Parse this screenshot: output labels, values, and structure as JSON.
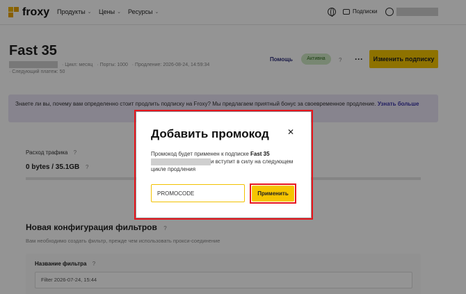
{
  "nav": {
    "logo_text": "froxy",
    "menu": [
      {
        "label": "Продукты"
      },
      {
        "label": "Цены"
      },
      {
        "label": "Ресурсы"
      }
    ],
    "subscriptions_label": "Подписки"
  },
  "page": {
    "title": "Fast 35",
    "meta_cycle": "· Цикл: месяц",
    "meta_ports": "· Порты: 1000",
    "meta_renewal": "· Продление: 2026-08-24, 14:59:34",
    "meta_next_payment": "· Следующий платеж: 50",
    "help_link": "Помощь",
    "status_badge": "Активна",
    "more_label": "···",
    "change_button": "Изменить подписку"
  },
  "notice": {
    "text": "Знаете ли вы, почему вам определенно стоит продлить подписку на Froxy? Мы предлагаем приятный бонус за своевременное продление. ",
    "link": "Узнать больше"
  },
  "traffic": {
    "label": "Расход трафика",
    "value": "0 bytes / 35.1GB",
    "used_fraction": 0
  },
  "filters": {
    "section_title": "Новая конфигурация фильтров",
    "section_sub": "Вам необходимо создать фильтр, прежде чем использовать прокси-соединение",
    "name_label": "Название фильтра",
    "name_value": "Filter 2026-07-24, 15:44"
  },
  "modal": {
    "title": "Добавить промокод",
    "text_before": "Промокод будет применен к подписке ",
    "subscription_name": "Fast 35",
    "text_after": "и вступит в силу на следующем цикле продления",
    "input_value": "PROMOCODE",
    "apply_button": "Применить",
    "close_label": "✕"
  },
  "colors": {
    "accent": "#f5c400",
    "highlight_outline": "#e8141b",
    "notice_bg": "#e8e4f5",
    "status_bg": "#cfe8c4"
  }
}
